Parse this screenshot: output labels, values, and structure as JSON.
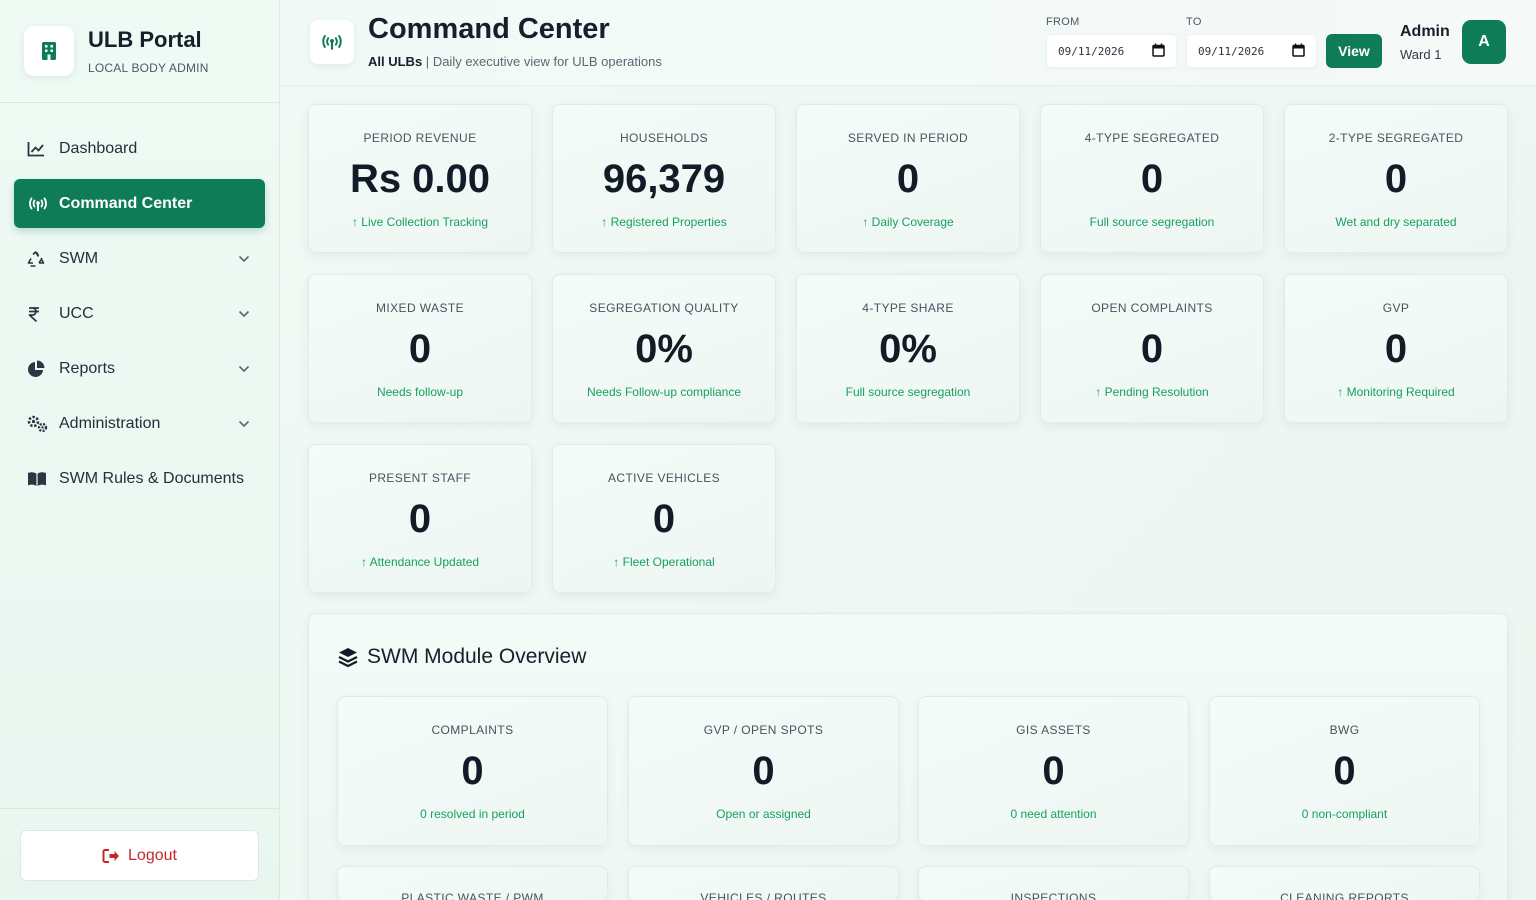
{
  "brand": {
    "title": "ULB Portal",
    "subtitle": "LOCAL BODY ADMIN",
    "icon": "building-icon"
  },
  "sidebar": {
    "items": [
      {
        "label": "Dashboard",
        "icon": "chart-line-icon",
        "active": false,
        "expandable": false
      },
      {
        "label": "Command Center",
        "icon": "broadcast-tower-icon",
        "active": true,
        "expandable": false
      },
      {
        "label": "SWM",
        "icon": "recycle-icon",
        "active": false,
        "expandable": true
      },
      {
        "label": "UCC",
        "icon": "rupee-icon",
        "active": false,
        "expandable": true
      },
      {
        "label": "Reports",
        "icon": "pie-chart-icon",
        "active": false,
        "expandable": true
      },
      {
        "label": "Administration",
        "icon": "cogs-icon",
        "active": false,
        "expandable": true
      },
      {
        "label": "SWM Rules & Documents",
        "icon": "book-icon",
        "active": false,
        "expandable": false
      }
    ],
    "logout_label": "Logout"
  },
  "header": {
    "title": "Command Center",
    "scope": "All ULBs",
    "separator": "|",
    "subtitle": "Daily executive view for ULB operations",
    "from_label": "FROM",
    "from_value": "09/11/2026",
    "to_label": "TO",
    "to_value": "09/11/2026",
    "view_label": "View",
    "user_name": "Admin",
    "user_ward": "Ward 1",
    "avatar_letter": "A"
  },
  "stats": [
    {
      "label": "PERIOD REVENUE",
      "value": "Rs 0.00",
      "note": "↑ Live Collection Tracking"
    },
    {
      "label": "HOUSEHOLDS",
      "value": "96,379",
      "note": "↑ Registered Properties"
    },
    {
      "label": "SERVED IN PERIOD",
      "value": "0",
      "note": "↑ Daily Coverage"
    },
    {
      "label": "4-TYPE SEGREGATED",
      "value": "0",
      "note": "Full source segregation"
    },
    {
      "label": "2-TYPE SEGREGATED",
      "value": "0",
      "note": "Wet and dry separated"
    },
    {
      "label": "MIXED WASTE",
      "value": "0",
      "note": "Needs follow-up"
    },
    {
      "label": "SEGREGATION QUALITY",
      "value": "0%",
      "note": "Needs Follow-up compliance"
    },
    {
      "label": "4-TYPE SHARE",
      "value": "0%",
      "note": "Full source segregation"
    },
    {
      "label": "OPEN COMPLAINTS",
      "value": "0",
      "note": "↑ Pending Resolution"
    },
    {
      "label": "GVP",
      "value": "0",
      "note": "↑ Monitoring Required"
    },
    {
      "label": "PRESENT STAFF",
      "value": "0",
      "note": "↑ Attendance Updated"
    },
    {
      "label": "ACTIVE VEHICLES",
      "value": "0",
      "note": "↑ Fleet Operational"
    }
  ],
  "swm_overview": {
    "title": "SWM Module Overview",
    "icon": "layers-icon",
    "cards": [
      {
        "label": "COMPLAINTS",
        "value": "0",
        "note": "0 resolved in period"
      },
      {
        "label": "GVP / OPEN SPOTS",
        "value": "0",
        "note": "Open or assigned"
      },
      {
        "label": "GIS ASSETS",
        "value": "0",
        "note": "0 need attention"
      },
      {
        "label": "BWG",
        "value": "0",
        "note": "0 non-compliant"
      },
      {
        "label": "PLASTIC WASTE / PWM",
        "value": "",
        "note": ""
      },
      {
        "label": "VEHICLES / ROUTES",
        "value": "",
        "note": ""
      },
      {
        "label": "INSPECTIONS",
        "value": "",
        "note": ""
      },
      {
        "label": "CLEANING REPORTS",
        "value": "",
        "note": ""
      }
    ]
  },
  "colors": {
    "accent": "#0e7d57",
    "positive": "#17a060",
    "danger": "#c62828"
  }
}
